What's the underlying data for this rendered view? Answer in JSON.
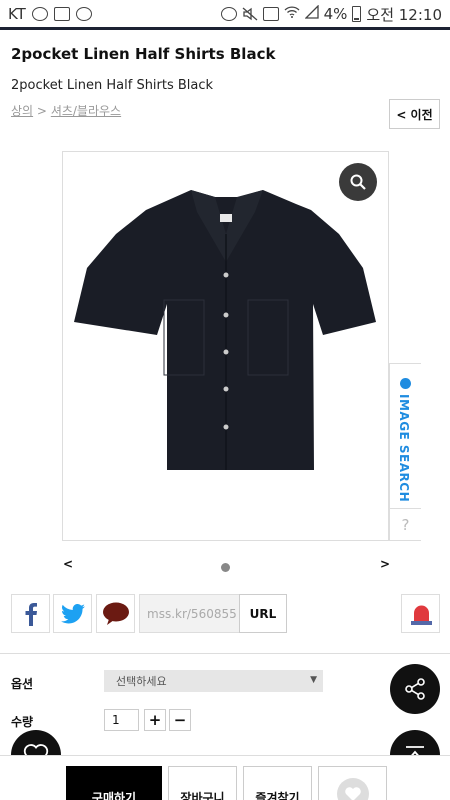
{
  "status_bar": {
    "carrier": "KT",
    "battery": "4%",
    "time": "오전 12:10"
  },
  "product": {
    "title": "2pocket Linen Half Shirts Black",
    "subtitle": "2pocket Linen Half Shirts Black"
  },
  "breadcrumb": {
    "level1": "상의",
    "separator": ">",
    "level2": "셔츠/블라우스"
  },
  "prev_button": "< 이전",
  "image_search": {
    "label": "IMAGE SEARCH",
    "help": "?"
  },
  "carousel": {
    "prev": "<",
    "next": ">"
  },
  "share": {
    "url_value": "mss.kr/560855",
    "url_button": "URL"
  },
  "options": {
    "option_label": "옵션",
    "option_select": "선택하세요",
    "quantity_label": "수량",
    "quantity_value": "1",
    "plus": "+",
    "minus": "−"
  },
  "bottom_bar": {
    "buy": "구매하기",
    "cart": "장바구니",
    "favorite": "즐겨찾기"
  },
  "colors": {
    "accent_blue": "#1f8ce0",
    "facebook": "#3b5998",
    "twitter": "#1da1f2",
    "dark": "#111111"
  }
}
